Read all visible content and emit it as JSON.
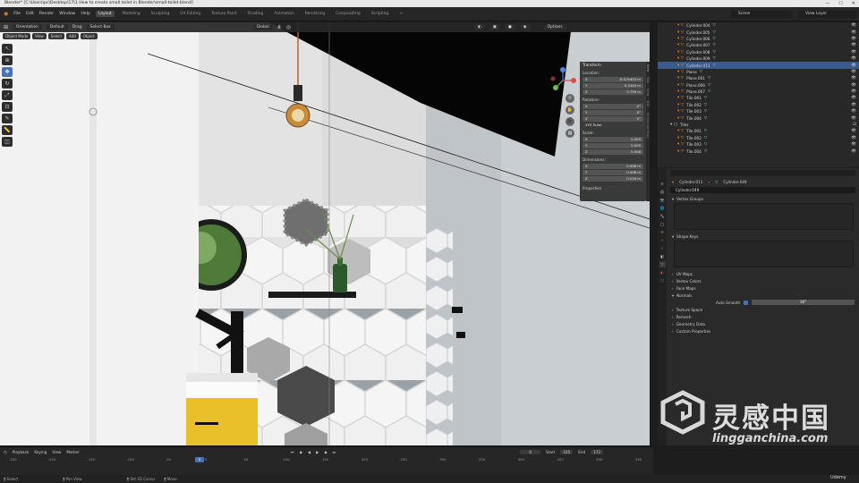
{
  "window": {
    "title": "Blender* [C:\\Users\\pc\\Desktop\\17\\1 How to create small toilet in Blender\\small-toilet.blend]",
    "controls": [
      "—",
      "☐",
      "✕"
    ]
  },
  "menubar": {
    "items": [
      "File",
      "Edit",
      "Render",
      "Window",
      "Help"
    ],
    "workspaces": [
      "Layout",
      "Modeling",
      "Sculpting",
      "UV Editing",
      "Texture Paint",
      "Shading",
      "Animation",
      "Rendering",
      "Compositing",
      "Scripting"
    ],
    "active_workspace": "Layout",
    "scene": "Scene",
    "view_layer": "View Layer"
  },
  "viewport": {
    "orientation_label": "Orientation",
    "orientation_value": "Default",
    "drag_label": "Drag",
    "drag_value": "Select Box",
    "transform_orientation": "Global",
    "options_label": "Options",
    "mode": "Object Mode",
    "header_menus": [
      "View",
      "Select",
      "Add",
      "Object"
    ],
    "colors": {
      "wall_left": "#f1f1f1",
      "wall_right": "#c9ced3",
      "ceiling": "#050505",
      "counter": "#e9bf2a",
      "tile_dark": "#4a4a4a",
      "tile_light": "#f5f5f5",
      "mirror_frame": "#1c1c1c",
      "bottle": "#2d5a2a"
    }
  },
  "npanel": {
    "header": "Transform",
    "location_label": "Location:",
    "location": [
      {
        "axis": "X",
        "value": "-0.019403 m"
      },
      {
        "axis": "Y",
        "value": "0.3445 m"
      },
      {
        "axis": "Z",
        "value": "0.735 m"
      }
    ],
    "rotation_label": "Rotation:",
    "rotation": [
      {
        "axis": "X",
        "value": "0°"
      },
      {
        "axis": "Y",
        "value": "0°"
      },
      {
        "axis": "Z",
        "value": "0°"
      }
    ],
    "rotation_mode": "XYZ Euler",
    "scale_label": "Scale:",
    "scale": [
      {
        "axis": "X",
        "value": "0.005"
      },
      {
        "axis": "Y",
        "value": "0.005"
      },
      {
        "axis": "Z",
        "value": "0.008"
      }
    ],
    "dimensions_label": "Dimensions:",
    "dimensions": [
      {
        "axis": "X",
        "value": "0.008 m"
      },
      {
        "axis": "Y",
        "value": "0.008 m"
      },
      {
        "axis": "Z",
        "value": "0.016 m"
      }
    ],
    "properties_label": "Properties",
    "tabs": [
      "Item",
      "Tool",
      "View",
      "Edit",
      "Screencast Keys"
    ]
  },
  "outliner": {
    "rows": [
      {
        "name": "Cylinder.004",
        "kind": "child",
        "selected": false
      },
      {
        "name": "Cylinder.005",
        "kind": "child",
        "selected": false
      },
      {
        "name": "Cylinder.006",
        "kind": "child",
        "selected": false
      },
      {
        "name": "Cylinder.007",
        "kind": "child",
        "selected": false
      },
      {
        "name": "Cylinder.008",
        "kind": "child",
        "selected": false
      },
      {
        "name": "Cylinder.009",
        "kind": "child",
        "selected": false
      },
      {
        "name": "Cylinder.011",
        "kind": "child",
        "selected": true
      },
      {
        "name": "Plane",
        "kind": "child",
        "selected": false
      },
      {
        "name": "Plane.001",
        "kind": "child",
        "selected": false
      },
      {
        "name": "Plane.006",
        "kind": "child",
        "selected": false
      },
      {
        "name": "Plane.007",
        "kind": "child",
        "selected": false
      },
      {
        "name": "Tile.001",
        "kind": "child",
        "selected": false
      },
      {
        "name": "Tile.002",
        "kind": "child",
        "selected": false
      },
      {
        "name": "Tile.003",
        "kind": "child",
        "selected": false
      },
      {
        "name": "Tile.004",
        "kind": "child",
        "selected": false
      },
      {
        "name": "Tiles",
        "kind": "group",
        "selected": false
      },
      {
        "name": "Tile.001",
        "kind": "child",
        "selected": false
      },
      {
        "name": "Tile.002",
        "kind": "child",
        "selected": false
      },
      {
        "name": "Tile.003",
        "kind": "child",
        "selected": false
      },
      {
        "name": "Tile.004",
        "kind": "child",
        "selected": false
      }
    ]
  },
  "properties": {
    "breadcrumb_object": "Cylinder.011",
    "breadcrumb_mesh": "Cylinder.049",
    "mesh_name": "Cylinder.049",
    "sections": {
      "vertex_groups": "Vertex Groups",
      "shape_keys": "Shape Keys",
      "uv_maps": "UV Maps",
      "vertex_colors": "Vertex Colors",
      "face_maps": "Face Maps",
      "normals": "Normals",
      "auto_smooth_label": "Auto Smooth",
      "auto_smooth_angle": "30°",
      "texture_space": "Texture Space",
      "remesh": "Remesh",
      "geometry_data": "Geometry Data",
      "custom_properties": "Custom Properties"
    },
    "tab_colors": [
      "#9a9a9a",
      "#9a9a9a",
      "#c98a4a",
      "#9a9a9a",
      "#d9b24a",
      "#d9d9d9",
      "#d96b3a",
      "#6b9ad9",
      "#3ab0d9",
      "#d9d9d9",
      "#6bd98a",
      "#d95a5a",
      "#9a9ad9"
    ]
  },
  "timeline": {
    "menus": [
      "Playback",
      "Keying",
      "View",
      "Marker"
    ],
    "current_frame": "0",
    "start_label": "Start",
    "start": "105",
    "end_label": "End",
    "end": "172",
    "ruler": [
      "-250",
      "-200",
      "-150",
      "-100",
      "-50",
      "0",
      "50",
      "100",
      "150",
      "200",
      "250",
      "300",
      "350",
      "400",
      "450",
      "500",
      "550"
    ],
    "playhead": "0"
  },
  "status": {
    "items": [
      "Select",
      "Pan View",
      "Set 3D Cursor",
      "Move"
    ],
    "udemy": "Udemy"
  },
  "watermark": {
    "cn_text": "灵感中国",
    "url": "lingganchina.com"
  }
}
